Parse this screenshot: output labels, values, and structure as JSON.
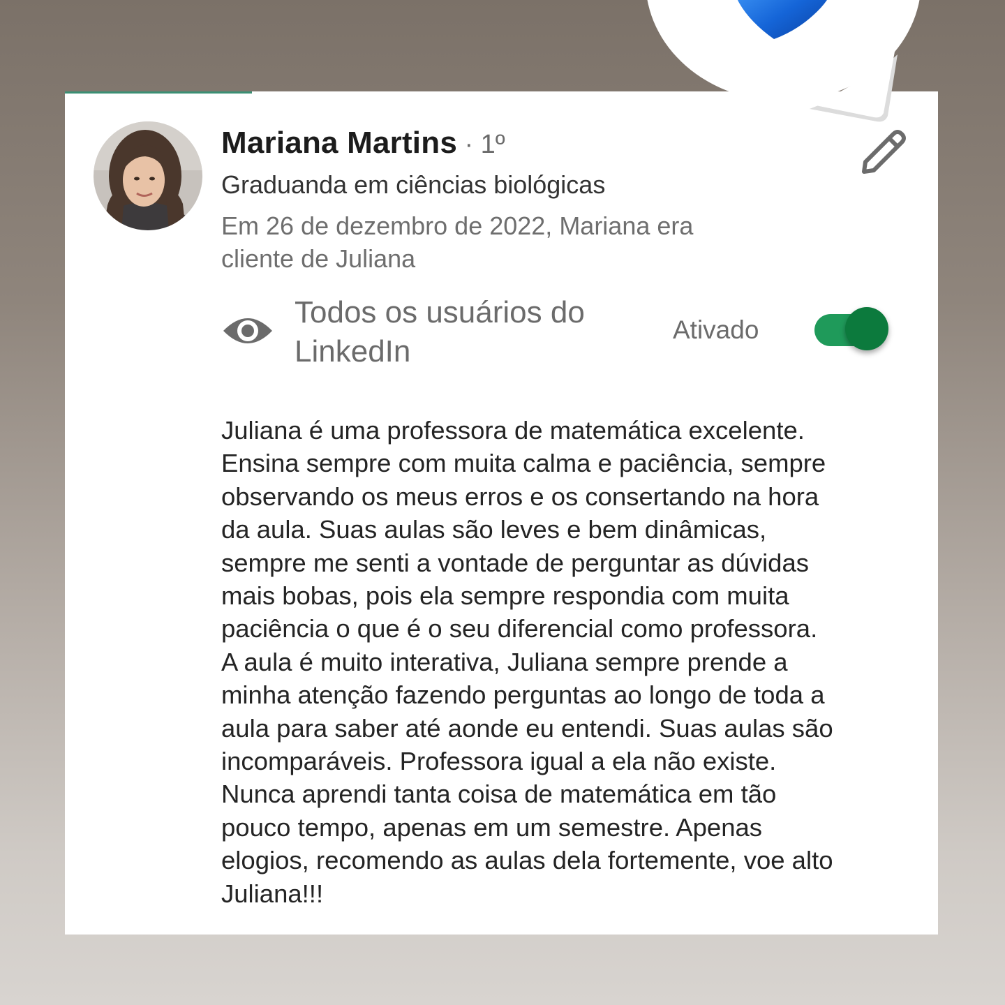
{
  "recommender": {
    "name": "Mariana Martins",
    "degree": "· 1º",
    "headline": "Graduanda em ciências biológicas",
    "relation": "Em 26 de dezembro de 2022, Mariana era cliente de Juliana"
  },
  "visibility": {
    "label": "Todos os usuários do LinkedIn",
    "status": "Ativado",
    "enabled": true
  },
  "recommendation": {
    "lines": [
      "Juliana é uma professora de matemática excelente.",
      "Ensina sempre com muita calma e paciência, sempre",
      "observando os meus erros e os consertando na hora",
      "da aula. Suas aulas são leves e bem dinâmicas,",
      "sempre me senti a vontade de perguntar as dúvidas",
      "mais bobas, pois ela sempre respondia com muita",
      "paciência o que é o seu diferencial como professora.",
      "A aula é muito interativa, Juliana sempre prende a",
      "minha atenção fazendo perguntas ao longo de toda a",
      "aula para saber até aonde eu entendi. Suas aulas são",
      "incomparáveis. Professora igual a ela não existe.",
      "Nunca aprendi tanta coisa de matemática em tão",
      "pouco tempo, apenas em um semestre. Apenas",
      "elogios, recomendo as aulas dela fortemente, voe alto",
      "Juliana!!!"
    ]
  },
  "icons": {
    "edit": "pencil-icon",
    "visibility": "eye-icon",
    "sticker": "blue-heart-icon"
  },
  "colors": {
    "toggle_track": "#1f9a5a",
    "toggle_knob": "#0c7a3d",
    "accent_line": "#3b8f74",
    "heart": "#1565d8"
  }
}
